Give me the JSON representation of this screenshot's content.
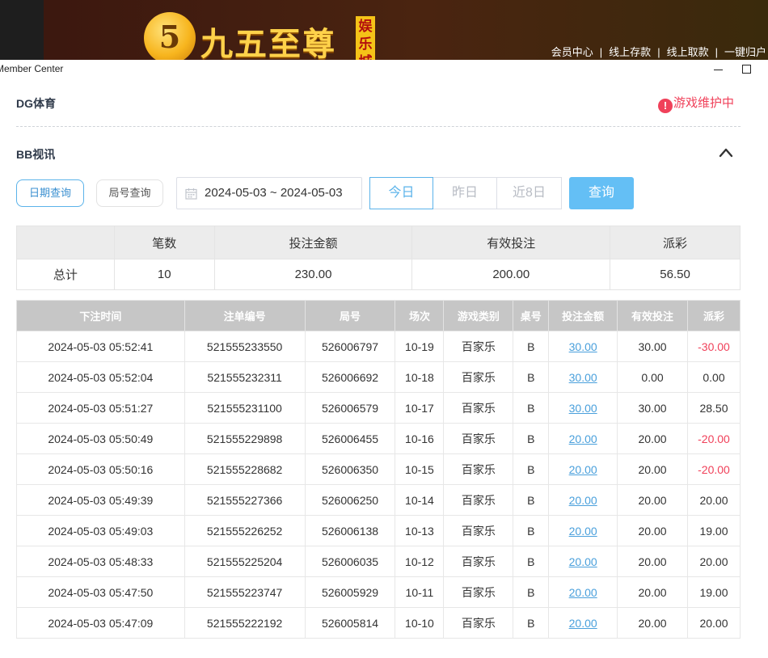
{
  "banner": {
    "logo_mark": "5",
    "logo_text": "九五至尊",
    "logo_badge": "娱乐城",
    "links": [
      "会员中心",
      "线上存款",
      "线上取款",
      "一键归户"
    ]
  },
  "window": {
    "title": "Member Center"
  },
  "sections": {
    "dg": {
      "title": "DG体育",
      "status": "游戏维护中"
    },
    "bb": {
      "title": "BB视讯"
    }
  },
  "filters": {
    "date_query_label": "日期查询",
    "round_query_label": "局号查询",
    "date_range": "2024-05-03 ~ 2024-05-03",
    "quick": [
      "今日",
      "昨日",
      "近8日"
    ],
    "query_button": "查询"
  },
  "summary": {
    "headers": [
      "",
      "笔数",
      "投注金额",
      "有效投注",
      "派彩"
    ],
    "row": [
      "总计",
      "10",
      "230.00",
      "200.00",
      "56.50"
    ]
  },
  "detail": {
    "headers": [
      "下注时间",
      "注单编号",
      "局号",
      "场次",
      "游戏类别",
      "桌号",
      "投注金额",
      "有效投注",
      "派彩"
    ],
    "rows": [
      [
        "2024-05-03 05:52:41",
        "521555233550",
        "526006797",
        "10-19",
        "百家乐",
        "B",
        "30.00",
        "30.00",
        "-30.00"
      ],
      [
        "2024-05-03 05:52:04",
        "521555232311",
        "526006692",
        "10-18",
        "百家乐",
        "B",
        "30.00",
        "0.00",
        "0.00"
      ],
      [
        "2024-05-03 05:51:27",
        "521555231100",
        "526006579",
        "10-17",
        "百家乐",
        "B",
        "30.00",
        "30.00",
        "28.50"
      ],
      [
        "2024-05-03 05:50:49",
        "521555229898",
        "526006455",
        "10-16",
        "百家乐",
        "B",
        "20.00",
        "20.00",
        "-20.00"
      ],
      [
        "2024-05-03 05:50:16",
        "521555228682",
        "526006350",
        "10-15",
        "百家乐",
        "B",
        "20.00",
        "20.00",
        "-20.00"
      ],
      [
        "2024-05-03 05:49:39",
        "521555227366",
        "526006250",
        "10-14",
        "百家乐",
        "B",
        "20.00",
        "20.00",
        "20.00"
      ],
      [
        "2024-05-03 05:49:03",
        "521555226252",
        "526006138",
        "10-13",
        "百家乐",
        "B",
        "20.00",
        "20.00",
        "19.00"
      ],
      [
        "2024-05-03 05:48:33",
        "521555225204",
        "526006035",
        "10-12",
        "百家乐",
        "B",
        "20.00",
        "20.00",
        "20.00"
      ],
      [
        "2024-05-03 05:47:50",
        "521555223747",
        "526005929",
        "10-11",
        "百家乐",
        "B",
        "20.00",
        "20.00",
        "19.00"
      ],
      [
        "2024-05-03 05:47:09",
        "521555222192",
        "526005814",
        "10-10",
        "百家乐",
        "B",
        "20.00",
        "20.00",
        "20.00"
      ]
    ]
  },
  "colors": {
    "accent": "#5bb3ea",
    "negative": "#f0415a",
    "button": "#64bff5",
    "header_gray": "#c6c6c6"
  }
}
